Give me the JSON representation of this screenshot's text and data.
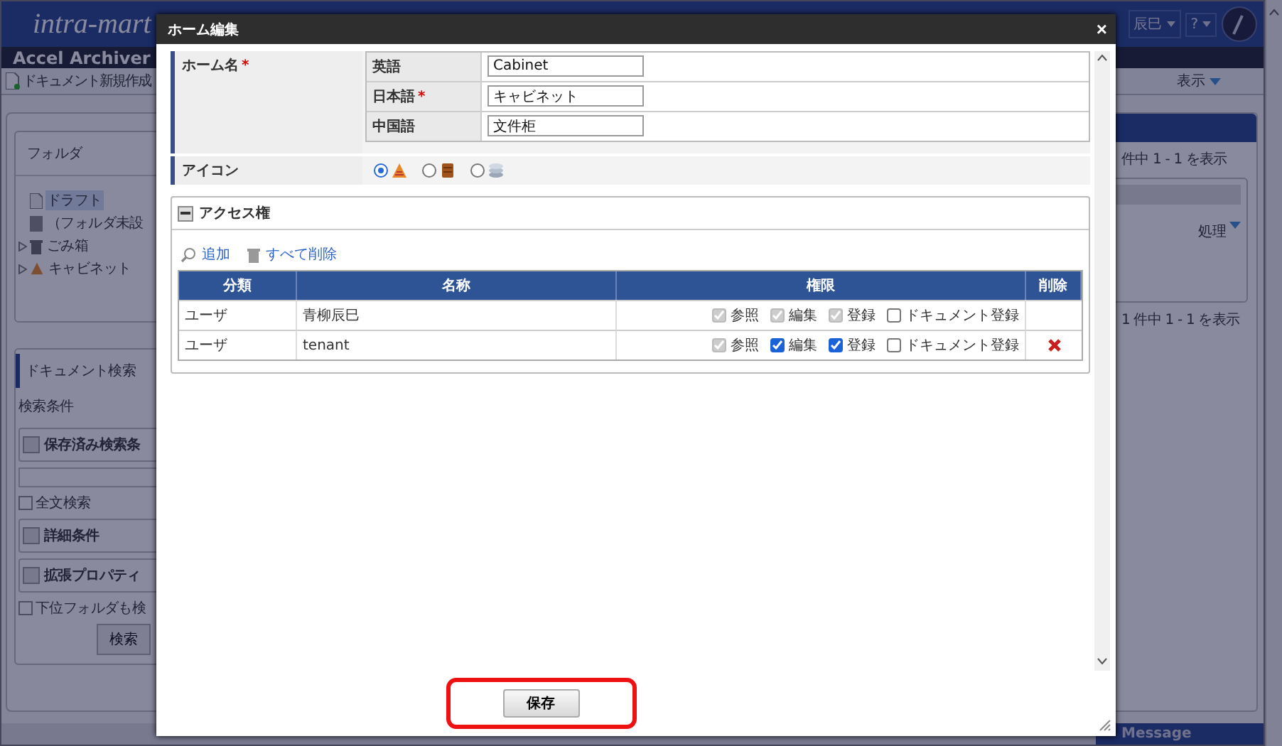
{
  "background": {
    "logo": "intra-mart",
    "user_menu": "辰巳",
    "help_menu": "?",
    "app_title": "Accel Archiver",
    "toolbar": {
      "new_document": "ドキュメント新規作成",
      "view_menu": "表示"
    },
    "folder_panel": {
      "title": "フォルダ",
      "items": [
        {
          "label": "ドラフト",
          "kind": "draft",
          "selected": true
        },
        {
          "label": "（フォルダ未設",
          "kind": "unfiled",
          "selected": false
        },
        {
          "label": "ごみ箱",
          "kind": "trash",
          "selected": false
        },
        {
          "label": "キャビネット",
          "kind": "cabinet",
          "selected": false
        }
      ]
    },
    "search_panel": {
      "tab": "ドキュメント検索",
      "subtitle": "検索条件",
      "rows": [
        {
          "kind": "section",
          "label": "保存済み検索条"
        },
        {
          "kind": "field"
        },
        {
          "kind": "checkbox",
          "label": "全文検索",
          "checked": false
        },
        {
          "kind": "section",
          "label": "詳細条件"
        },
        {
          "kind": "section",
          "label": "拡張プロパティ"
        },
        {
          "kind": "checkbox",
          "label": "下位フォルダも検",
          "checked": false
        }
      ],
      "button": "検索"
    },
    "result_panel": {
      "count_top": "件中 1 - 1 を表示",
      "action_menu": "処理",
      "count_bottom": "1 件中 1 - 1 を表示"
    },
    "message_bar": "Message"
  },
  "dialog": {
    "title": "ホーム編集",
    "close": "×",
    "required_mark": "*",
    "home_name": {
      "label": "ホーム名",
      "required": true,
      "languages": [
        {
          "label": "英語",
          "required": false,
          "value": "Cabinet"
        },
        {
          "label": "日本語",
          "required": true,
          "value": "キャビネット"
        },
        {
          "label": "中国語",
          "required": false,
          "value": "文件柜"
        }
      ]
    },
    "icon_row": {
      "label": "アイコン",
      "options": [
        {
          "kind": "cone",
          "selected": true
        },
        {
          "kind": "cabinet",
          "selected": false
        },
        {
          "kind": "database",
          "selected": false
        }
      ]
    },
    "access": {
      "title": "アクセス権",
      "expanded": true,
      "actions": [
        "追加",
        "すべて削除"
      ],
      "columns": [
        "分類",
        "名称",
        "権限",
        "削除"
      ],
      "rows": [
        {
          "category": "ユーザ",
          "name": "青柳辰巳",
          "deletable": false,
          "permissions": [
            {
              "label": "参照",
              "checked": true,
              "disabled": true
            },
            {
              "label": "編集",
              "checked": true,
              "disabled": true
            },
            {
              "label": "登録",
              "checked": true,
              "disabled": true
            },
            {
              "label": "ドキュメント登録",
              "checked": false,
              "disabled": false
            }
          ]
        },
        {
          "category": "ユーザ",
          "name": "tenant",
          "deletable": true,
          "permissions": [
            {
              "label": "参照",
              "checked": true,
              "disabled": true
            },
            {
              "label": "編集",
              "checked": true,
              "disabled": false
            },
            {
              "label": "登録",
              "checked": true,
              "disabled": false
            },
            {
              "label": "ドキュメント登録",
              "checked": false,
              "disabled": false
            }
          ]
        }
      ]
    },
    "save_button": "保存"
  }
}
